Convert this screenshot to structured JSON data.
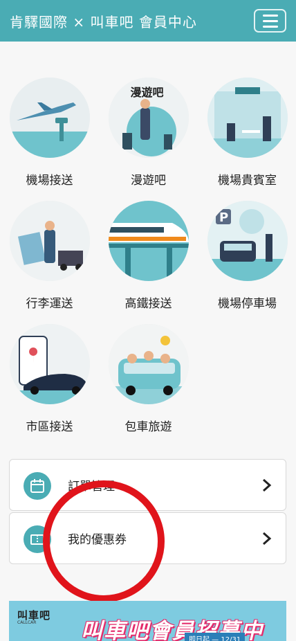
{
  "header": {
    "title": "肯驛國際 × 叫車吧 會員中心",
    "menu_icon": "hamburger-icon"
  },
  "services": [
    {
      "label": "機場接送",
      "icon": "airport-transfer-icon"
    },
    {
      "label": "漫遊吧",
      "icon": "roaming-icon",
      "badge": "漫遊吧"
    },
    {
      "label": "機場貴賓室",
      "icon": "airport-lounge-icon"
    },
    {
      "label": "行李運送",
      "icon": "luggage-delivery-icon"
    },
    {
      "label": "高鐵接送",
      "icon": "high-speed-rail-icon"
    },
    {
      "label": "機場停車場",
      "icon": "airport-parking-icon"
    },
    {
      "label": "市區接送",
      "icon": "city-transfer-icon"
    },
    {
      "label": "包車旅遊",
      "icon": "charter-tour-icon"
    }
  ],
  "cards": [
    {
      "label": "訂單管理",
      "icon": "calendar-icon"
    },
    {
      "label": "我的優惠券",
      "icon": "coupon-icon"
    }
  ],
  "banner": {
    "logo": "叫車吧",
    "logo_sub": "CALLCAR",
    "headline": "叫車吧會員招募中",
    "date": "即日起 — 12/31"
  },
  "colors": {
    "primary": "#4aacb4",
    "annotation": "#e0141b"
  }
}
